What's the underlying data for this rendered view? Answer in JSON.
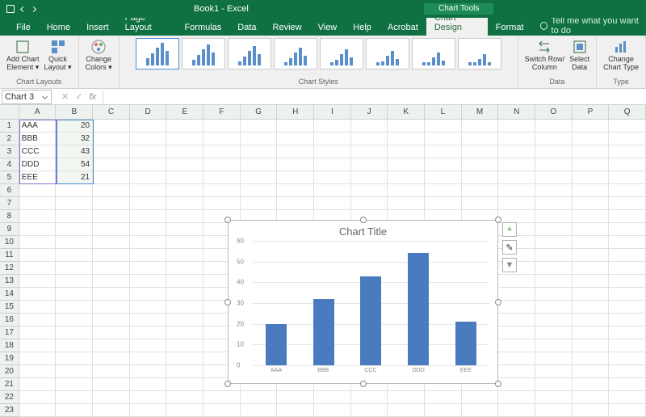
{
  "titlebar": {
    "title": "Book1 - Excel",
    "chart_tools": "Chart Tools"
  },
  "tabs": [
    "File",
    "Home",
    "Insert",
    "Page Layout",
    "Formulas",
    "Data",
    "Review",
    "View",
    "Help",
    "Acrobat",
    "Chart Design",
    "Format"
  ],
  "tellme": "Tell me what you want to do",
  "ribbon": {
    "layouts": {
      "add_el": "Add Chart\nElement ▾",
      "quick": "Quick\nLayout ▾",
      "label": "Chart Layouts"
    },
    "colors": {
      "btn": "Change\nColors ▾"
    },
    "styles_label": "Chart Styles",
    "data": {
      "switch": "Switch Row/\nColumn",
      "select": "Select\nData",
      "label": "Data"
    },
    "type": {
      "change": "Change\nChart Type",
      "label": "Type"
    }
  },
  "namebox": "Chart 3",
  "fx": "fx",
  "columns": [
    "A",
    "B",
    "C",
    "D",
    "E",
    "F",
    "G",
    "H",
    "I",
    "J",
    "K",
    "L",
    "M",
    "N",
    "O",
    "P",
    "Q"
  ],
  "rows": [
    1,
    2,
    3,
    4,
    5,
    6,
    7,
    8,
    9,
    10,
    11,
    12,
    13,
    14,
    15,
    16,
    17,
    18,
    19,
    20,
    21,
    22,
    23
  ],
  "cells": {
    "A": [
      "AAA",
      "BBB",
      "CCC",
      "DDD",
      "EEE"
    ],
    "B": [
      20,
      32,
      43,
      54,
      21
    ]
  },
  "chart_data": {
    "type": "bar",
    "title": "Chart Title",
    "categories": [
      "AAA",
      "BBB",
      "CCC",
      "DDD",
      "EEE"
    ],
    "values": [
      20,
      32,
      43,
      54,
      21
    ],
    "ylim": [
      0,
      60
    ],
    "yticks": [
      0,
      10,
      20,
      30,
      40,
      50,
      60
    ],
    "xlabel": "",
    "ylabel": ""
  },
  "chart_buttons": {
    "plus": "+",
    "brush": "✎",
    "filter": "▼"
  }
}
